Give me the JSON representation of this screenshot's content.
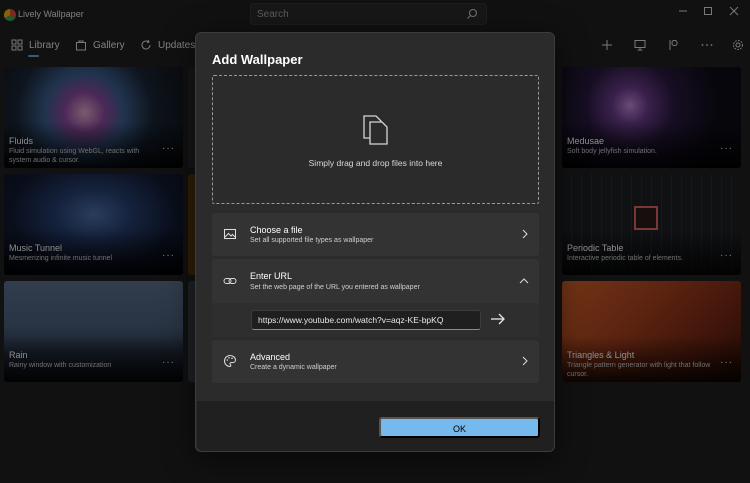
{
  "app": {
    "title": "Lively Wallpaper"
  },
  "search": {
    "placeholder": "Search"
  },
  "nav": {
    "tabs": [
      {
        "label": "Library",
        "icon": "grid-icon",
        "selected": true
      },
      {
        "label": "Gallery",
        "icon": "bag-icon"
      },
      {
        "label": "Updates",
        "icon": "refresh-icon"
      }
    ],
    "actions": [
      "add-icon",
      "monitor-icon",
      "control-panel-icon",
      "more-icon",
      "gear-icon"
    ]
  },
  "cards": [
    {
      "title": "Fluids",
      "desc": "Fluid simulation using WebGL, reacts with system audio & cursor."
    },
    {
      "title": "Music Tunnel",
      "desc": "Mesmerizing infinite music tunnel"
    },
    {
      "title": "Rain",
      "desc": "Rainy window with customization"
    },
    {
      "title": "Medusae",
      "desc": "Soft body jellyfish simulation."
    },
    {
      "title": "Periodic Table",
      "desc": "Interactive periodic table of elements."
    },
    {
      "title": "Triangles & Light",
      "desc": "Triangle pattern generator with light that follow cursor."
    }
  ],
  "card_more": "···",
  "dialog": {
    "title": "Add Wallpaper",
    "dropzone_text": "Simply drag and drop files into here",
    "options": {
      "file": {
        "title": "Choose a file",
        "desc": "Set all supported file types as wallpaper"
      },
      "url": {
        "title": "Enter URL",
        "desc": "Set the web page of the URL you entered as wallpaper",
        "value": "https://www.youtube.com/watch?v=aqz-KE-bpKQ"
      },
      "advanced": {
        "title": "Advanced",
        "desc": "Create a dynamic wallpaper"
      }
    },
    "ok_label": "OK"
  },
  "colors": {
    "accent": "#76b9ed",
    "tab_indicator": "#5aa9e6",
    "background": "#202020",
    "dialog": "#2b2b2b"
  }
}
